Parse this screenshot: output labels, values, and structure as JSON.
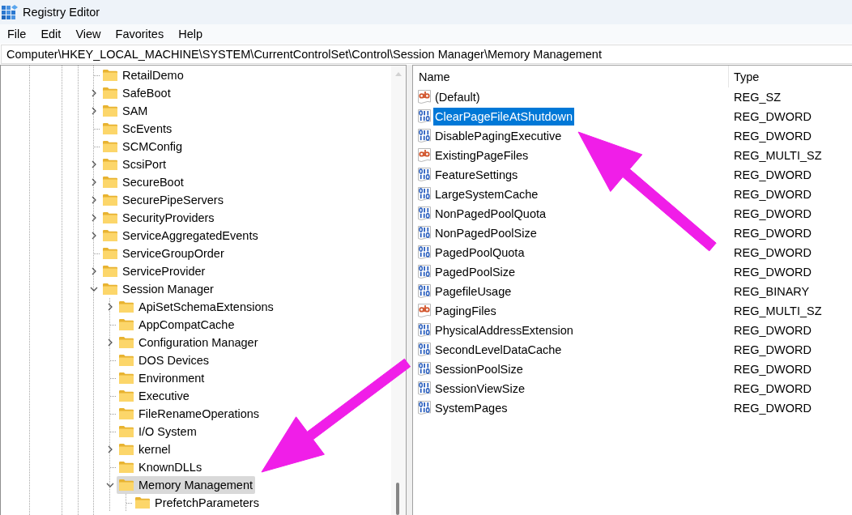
{
  "window": {
    "title": "Registry Editor"
  },
  "menu": [
    "File",
    "Edit",
    "View",
    "Favorites",
    "Help"
  ],
  "address": "Computer\\HKEY_LOCAL_MACHINE\\SYSTEM\\CurrentControlSet\\Control\\Session Manager\\Memory Management",
  "tree": {
    "items": [
      {
        "label": "RetailDemo",
        "selected": false
      },
      {
        "label": "SafeBoot",
        "expanded": false,
        "selected": false
      },
      {
        "label": "SAM",
        "expanded": false,
        "selected": false
      },
      {
        "label": "ScEvents",
        "selected": false
      },
      {
        "label": "SCMConfig",
        "selected": false
      },
      {
        "label": "ScsiPort",
        "expanded": false,
        "selected": false
      },
      {
        "label": "SecureBoot",
        "expanded": false,
        "selected": false
      },
      {
        "label": "SecurePipeServers",
        "expanded": false,
        "selected": false
      },
      {
        "label": "SecurityProviders",
        "expanded": false,
        "selected": false
      },
      {
        "label": "ServiceAggregatedEvents",
        "expanded": false,
        "selected": false
      },
      {
        "label": "ServiceGroupOrder",
        "selected": false
      },
      {
        "label": "ServiceProvider",
        "expanded": false,
        "selected": false
      },
      {
        "label": "Session Manager",
        "expanded": true,
        "selected": false,
        "children": [
          {
            "label": "ApiSetSchemaExtensions",
            "expanded": false,
            "selected": false
          },
          {
            "label": "AppCompatCache",
            "selected": false
          },
          {
            "label": "Configuration Manager",
            "expanded": false,
            "selected": false
          },
          {
            "label": "DOS Devices",
            "selected": false
          },
          {
            "label": "Environment",
            "selected": false
          },
          {
            "label": "Executive",
            "selected": false
          },
          {
            "label": "FileRenameOperations",
            "selected": false
          },
          {
            "label": "I/O System",
            "selected": false
          },
          {
            "label": "kernel",
            "expanded": false,
            "selected": false
          },
          {
            "label": "KnownDLLs",
            "selected": false
          },
          {
            "label": "Memory Management",
            "expanded": true,
            "selected": true,
            "children": [
              {
                "label": "PrefetchParameters",
                "selected": false
              }
            ]
          }
        ]
      }
    ]
  },
  "values": {
    "columns": [
      "Name",
      "Type"
    ],
    "rows": [
      {
        "name": "(Default)",
        "type": "REG_SZ",
        "kind": "string",
        "selected": false
      },
      {
        "name": "ClearPageFileAtShutdown",
        "type": "REG_DWORD",
        "kind": "binary",
        "selected": true
      },
      {
        "name": "DisablePagingExecutive",
        "type": "REG_DWORD",
        "kind": "binary",
        "selected": false
      },
      {
        "name": "ExistingPageFiles",
        "type": "REG_MULTI_SZ",
        "kind": "string",
        "selected": false
      },
      {
        "name": "FeatureSettings",
        "type": "REG_DWORD",
        "kind": "binary",
        "selected": false
      },
      {
        "name": "LargeSystemCache",
        "type": "REG_DWORD",
        "kind": "binary",
        "selected": false
      },
      {
        "name": "NonPagedPoolQuota",
        "type": "REG_DWORD",
        "kind": "binary",
        "selected": false
      },
      {
        "name": "NonPagedPoolSize",
        "type": "REG_DWORD",
        "kind": "binary",
        "selected": false
      },
      {
        "name": "PagedPoolQuota",
        "type": "REG_DWORD",
        "kind": "binary",
        "selected": false
      },
      {
        "name": "PagedPoolSize",
        "type": "REG_DWORD",
        "kind": "binary",
        "selected": false
      },
      {
        "name": "PagefileUsage",
        "type": "REG_BINARY",
        "kind": "binary",
        "selected": false
      },
      {
        "name": "PagingFiles",
        "type": "REG_MULTI_SZ",
        "kind": "string",
        "selected": false
      },
      {
        "name": "PhysicalAddressExtension",
        "type": "REG_DWORD",
        "kind": "binary",
        "selected": false
      },
      {
        "name": "SecondLevelDataCache",
        "type": "REG_DWORD",
        "kind": "binary",
        "selected": false
      },
      {
        "name": "SessionPoolSize",
        "type": "REG_DWORD",
        "kind": "binary",
        "selected": false
      },
      {
        "name": "SessionViewSize",
        "type": "REG_DWORD",
        "kind": "binary",
        "selected": false
      },
      {
        "name": "SystemPages",
        "type": "REG_DWORD",
        "kind": "binary",
        "selected": false
      }
    ]
  },
  "annotations": [
    {
      "kind": "arrow"
    },
    {
      "kind": "arrow"
    }
  ]
}
